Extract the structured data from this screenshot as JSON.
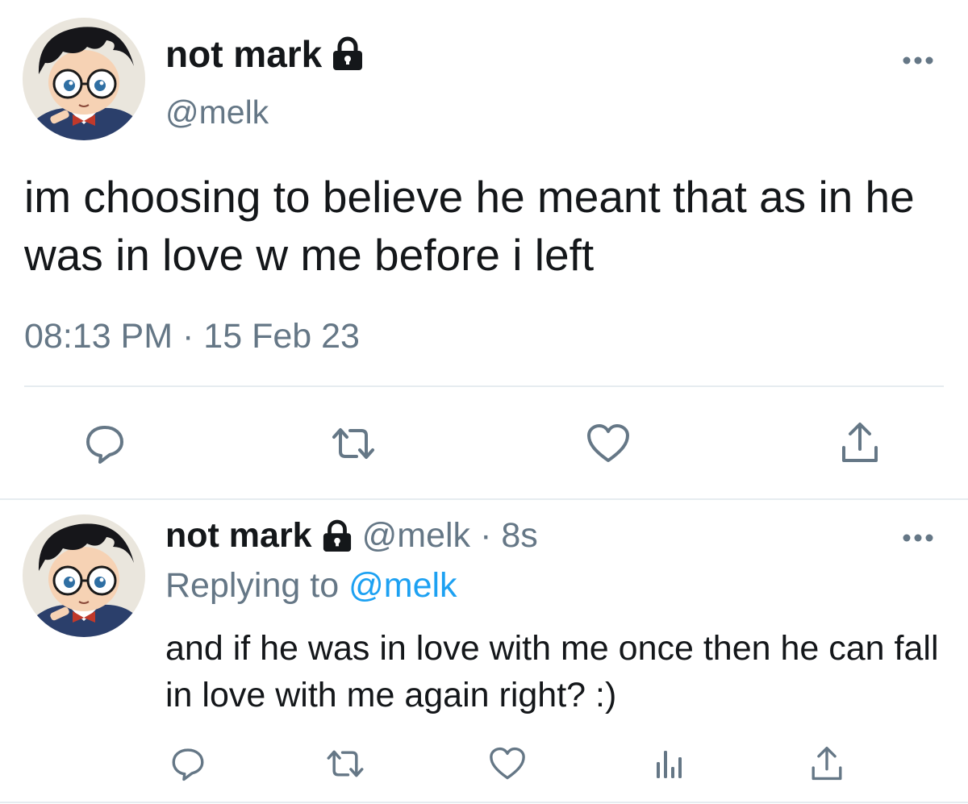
{
  "main_tweet": {
    "display_name": "not mark",
    "handle": "@melk",
    "text": "im choosing to believe he meant that as in he was in love w me before i left",
    "time": "08:13 PM",
    "separator": "·",
    "date": "15 Feb 23"
  },
  "reply_tweet": {
    "display_name": "not mark",
    "handle": "@melk",
    "separator": "·",
    "age": "8s",
    "replying_prefix": "Replying to",
    "replying_handle": "@melk",
    "text": "and if he was in love with me once then he can fall in love with me again right? :)"
  },
  "icons": {
    "lock": "lock-icon",
    "more": "more-icon",
    "reply": "reply-icon",
    "retweet": "retweet-icon",
    "like": "heart-icon",
    "analytics": "analytics-icon",
    "share": "share-icon"
  },
  "colors": {
    "text": "#14171a",
    "secondary": "#657786",
    "link": "#1da1f2",
    "divider": "#e6ecf0"
  }
}
